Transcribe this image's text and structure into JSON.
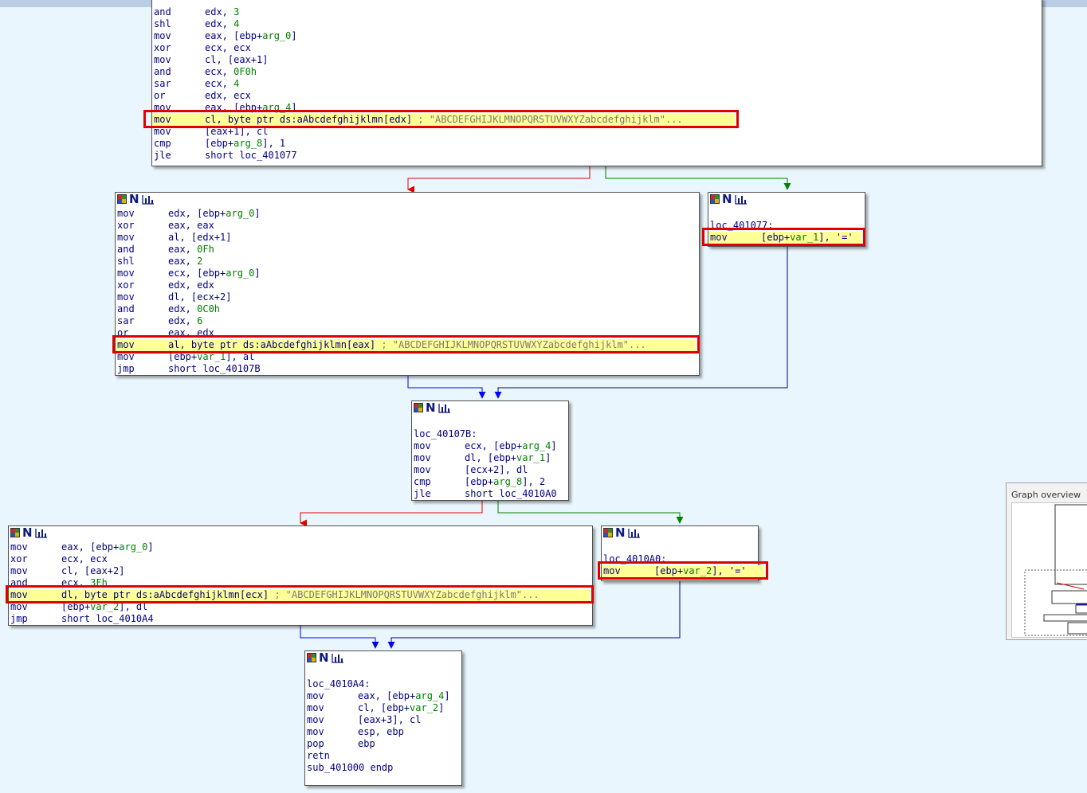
{
  "graph": {
    "blocks": [
      {
        "id": "b1",
        "lines": [
          [
            {
              "t": "and",
              "c": "mn"
            },
            {
              "t": "edx, "
            },
            {
              "t": "3",
              "c": "num"
            }
          ],
          [
            {
              "t": "shl",
              "c": "mn"
            },
            {
              "t": "edx, "
            },
            {
              "t": "4",
              "c": "num"
            }
          ],
          [
            {
              "t": "mov",
              "c": "mn"
            },
            {
              "t": "eax, [ebp+"
            },
            {
              "t": "arg_0",
              "c": "vr"
            },
            {
              "t": "]"
            }
          ],
          [
            {
              "t": "xor",
              "c": "mn"
            },
            {
              "t": "ecx, ecx"
            }
          ],
          [
            {
              "t": "mov",
              "c": "mn"
            },
            {
              "t": "cl, [eax+1]"
            }
          ],
          [
            {
              "t": "and",
              "c": "mn"
            },
            {
              "t": "ecx, "
            },
            {
              "t": "0F0h",
              "c": "num"
            }
          ],
          [
            {
              "t": "sar",
              "c": "mn"
            },
            {
              "t": "ecx, "
            },
            {
              "t": "4",
              "c": "num"
            }
          ],
          [
            {
              "t": "or",
              "c": "mn"
            },
            {
              "t": "edx, ecx"
            }
          ],
          [
            {
              "t": "mov",
              "c": "mn"
            },
            {
              "t": "eax, [ebp+"
            },
            {
              "t": "arg_4",
              "c": "vr"
            },
            {
              "t": "]"
            }
          ],
          [
            {
              "t": "mov",
              "c": "mn"
            },
            {
              "t": "cl, byte ptr ds:aAbcdefghijklmn[edx] "
            },
            {
              "t": "; \"ABCDEFGHIJKLMNOPQRSTUVWXYZabcdefghijklm\"...",
              "c": "cm"
            }
          ],
          [
            {
              "t": "mov",
              "c": "mn"
            },
            {
              "t": "[eax+1], cl"
            }
          ],
          [
            {
              "t": "cmp",
              "c": "mn"
            },
            {
              "t": "[ebp+"
            },
            {
              "t": "arg_8",
              "c": "vr"
            },
            {
              "t": "], 1"
            }
          ],
          [
            {
              "t": "jle",
              "c": "mn"
            },
            {
              "t": "short loc_401077"
            }
          ]
        ]
      },
      {
        "id": "b2",
        "lines": [
          [
            {
              "t": "mov",
              "c": "mn"
            },
            {
              "t": "edx, [ebp+"
            },
            {
              "t": "arg_0",
              "c": "vr"
            },
            {
              "t": "]"
            }
          ],
          [
            {
              "t": "xor",
              "c": "mn"
            },
            {
              "t": "eax, eax"
            }
          ],
          [
            {
              "t": "mov",
              "c": "mn"
            },
            {
              "t": "al, [edx+1]"
            }
          ],
          [
            {
              "t": "and",
              "c": "mn"
            },
            {
              "t": "eax, "
            },
            {
              "t": "0Fh",
              "c": "num"
            }
          ],
          [
            {
              "t": "shl",
              "c": "mn"
            },
            {
              "t": "eax, "
            },
            {
              "t": "2",
              "c": "num"
            }
          ],
          [
            {
              "t": "mov",
              "c": "mn"
            },
            {
              "t": "ecx, [ebp+"
            },
            {
              "t": "arg_0",
              "c": "vr"
            },
            {
              "t": "]"
            }
          ],
          [
            {
              "t": "xor",
              "c": "mn"
            },
            {
              "t": "edx, edx"
            }
          ],
          [
            {
              "t": "mov",
              "c": "mn"
            },
            {
              "t": "dl, [ecx+2]"
            }
          ],
          [
            {
              "t": "and",
              "c": "mn"
            },
            {
              "t": "edx, "
            },
            {
              "t": "0C0h",
              "c": "num"
            }
          ],
          [
            {
              "t": "sar",
              "c": "mn"
            },
            {
              "t": "edx, "
            },
            {
              "t": "6",
              "c": "num"
            }
          ],
          [
            {
              "t": "or",
              "c": "mn"
            },
            {
              "t": "eax, edx"
            }
          ],
          [
            {
              "t": "mov",
              "c": "mn"
            },
            {
              "t": "al, byte ptr ds:aAbcdefghijklmn[eax] "
            },
            {
              "t": "; \"ABCDEFGHIJKLMNOPQRSTUVWXYZabcdefghijklm\"...",
              "c": "cm"
            }
          ],
          [
            {
              "t": "mov",
              "c": "mn"
            },
            {
              "t": "[ebp+"
            },
            {
              "t": "var_1",
              "c": "vr"
            },
            {
              "t": "], al"
            }
          ],
          [
            {
              "t": "jmp",
              "c": "mn"
            },
            {
              "t": "short loc_40107B"
            }
          ]
        ]
      },
      {
        "id": "b3",
        "lines": [
          [],
          [
            {
              "t": "loc_401077:"
            }
          ],
          [
            {
              "t": "mov",
              "c": "mn"
            },
            {
              "t": "[ebp+"
            },
            {
              "t": "var_1",
              "c": "vr"
            },
            {
              "t": "], '='"
            }
          ]
        ]
      },
      {
        "id": "b4",
        "lines": [
          [],
          [
            {
              "t": "loc_40107B:"
            }
          ],
          [
            {
              "t": "mov",
              "c": "mn"
            },
            {
              "t": "ecx, [ebp+"
            },
            {
              "t": "arg_4",
              "c": "vr"
            },
            {
              "t": "]"
            }
          ],
          [
            {
              "t": "mov",
              "c": "mn"
            },
            {
              "t": "dl, [ebp+"
            },
            {
              "t": "var_1",
              "c": "vr"
            },
            {
              "t": "]"
            }
          ],
          [
            {
              "t": "mov",
              "c": "mn"
            },
            {
              "t": "[ecx+2], dl"
            }
          ],
          [
            {
              "t": "cmp",
              "c": "mn"
            },
            {
              "t": "[ebp+"
            },
            {
              "t": "arg_8",
              "c": "vr"
            },
            {
              "t": "], 2"
            }
          ],
          [
            {
              "t": "jle",
              "c": "mn"
            },
            {
              "t": "short loc_4010A0"
            }
          ]
        ]
      },
      {
        "id": "b5",
        "lines": [
          [
            {
              "t": "mov",
              "c": "mn"
            },
            {
              "t": "eax, [ebp+"
            },
            {
              "t": "arg_0",
              "c": "vr"
            },
            {
              "t": "]"
            }
          ],
          [
            {
              "t": "xor",
              "c": "mn"
            },
            {
              "t": "ecx, ecx"
            }
          ],
          [
            {
              "t": "mov",
              "c": "mn"
            },
            {
              "t": "cl, [eax+2]"
            }
          ],
          [
            {
              "t": "and",
              "c": "mn"
            },
            {
              "t": "ecx, "
            },
            {
              "t": "3Fh",
              "c": "num"
            }
          ],
          [
            {
              "t": "mov",
              "c": "mn"
            },
            {
              "t": "dl, byte ptr ds:aAbcdefghijklmn[ecx] "
            },
            {
              "t": "; \"ABCDEFGHIJKLMNOPQRSTUVWXYZabcdefghijklm\"...",
              "c": "cm"
            }
          ],
          [
            {
              "t": "mov",
              "c": "mn"
            },
            {
              "t": "[ebp+"
            },
            {
              "t": "var_2",
              "c": "vr"
            },
            {
              "t": "], dl"
            }
          ],
          [
            {
              "t": "jmp",
              "c": "mn"
            },
            {
              "t": "short loc_4010A4"
            }
          ]
        ]
      },
      {
        "id": "b6",
        "lines": [
          [],
          [
            {
              "t": "loc_4010A0:"
            }
          ],
          [
            {
              "t": "mov",
              "c": "mn"
            },
            {
              "t": "[ebp+"
            },
            {
              "t": "var_2",
              "c": "vr"
            },
            {
              "t": "], '='"
            }
          ]
        ]
      },
      {
        "id": "b7",
        "lines": [
          [],
          [
            {
              "t": "loc_4010A4:"
            }
          ],
          [
            {
              "t": "mov",
              "c": "mn"
            },
            {
              "t": "eax, [ebp+"
            },
            {
              "t": "arg_4",
              "c": "vr"
            },
            {
              "t": "]"
            }
          ],
          [
            {
              "t": "mov",
              "c": "mn"
            },
            {
              "t": "cl, [ebp+"
            },
            {
              "t": "var_2",
              "c": "vr"
            },
            {
              "t": "]"
            }
          ],
          [
            {
              "t": "mov",
              "c": "mn"
            },
            {
              "t": "[eax+3], cl"
            }
          ],
          [
            {
              "t": "mov",
              "c": "mn"
            },
            {
              "t": "esp, ebp"
            }
          ],
          [
            {
              "t": "pop",
              "c": "mn"
            },
            {
              "t": "ebp"
            }
          ],
          [
            {
              "t": "retn",
              "c": "mn"
            }
          ],
          [
            {
              "t": "sub_401000 endp"
            }
          ]
        ]
      }
    ]
  },
  "overview": {
    "title": "Graph overview"
  },
  "colors": {
    "background": "#eaf6fd",
    "edge_taken": "#008000",
    "edge_not_taken": "#e00000",
    "edge_unconditional": "#0000ff",
    "edge_merge": "#00007a",
    "highlight_fill": "#ffff98",
    "highlight_border": "#e00000"
  },
  "icons": [
    "graph-node-color-icon",
    "graph-node-n-icon",
    "graph-node-chart-icon"
  ]
}
